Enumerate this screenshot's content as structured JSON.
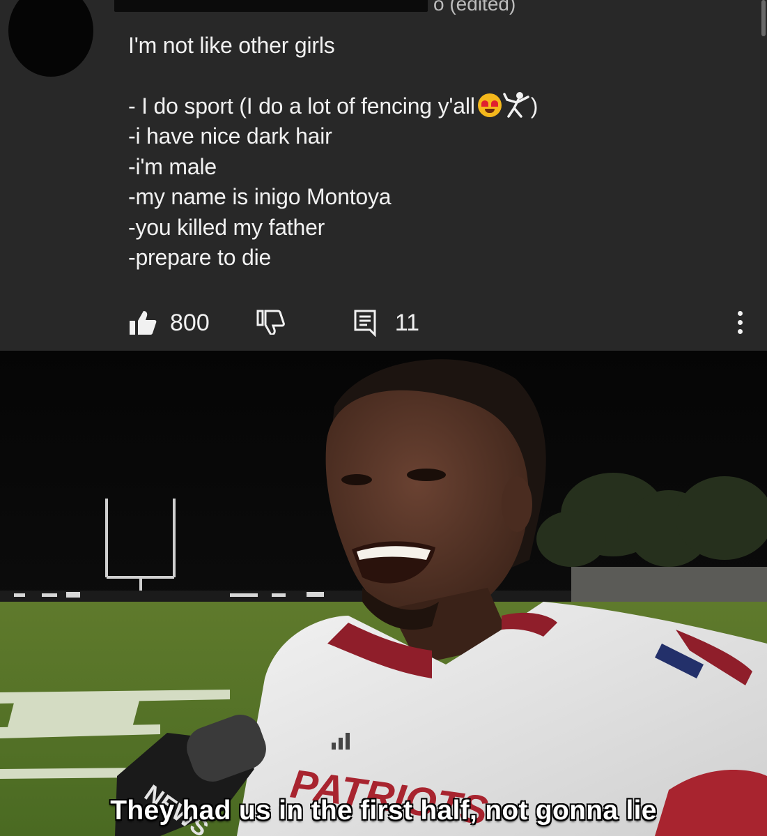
{
  "comment": {
    "time_suffix": "o (edited)",
    "lines": [
      "I'm not like other girls",
      "- I do sport (I do a lot of fencing y'all",
      "-i have nice dark hair",
      "-i'm male",
      "-my name is inigo Montoya",
      "-you killed my father",
      "-prepare to die"
    ],
    "line1_closing": ")",
    "emojis": [
      "heart-eyes-emoji",
      "fencer-emoji"
    ],
    "likes": "800",
    "replies": "11",
    "icons": [
      "thumbs-up-icon",
      "thumbs-down-icon",
      "reply-icon",
      "more-vert-icon"
    ]
  },
  "meme": {
    "caption": "They had us in the first half, not gonna lie",
    "mic_flag": "NEWS",
    "jersey_text": "PATRIOTS"
  },
  "colors": {
    "comment_bg": "#282828",
    "text": "#f1f1f1",
    "jersey": "#e9e9e9",
    "jersey_trim": "#9b1d2a"
  }
}
